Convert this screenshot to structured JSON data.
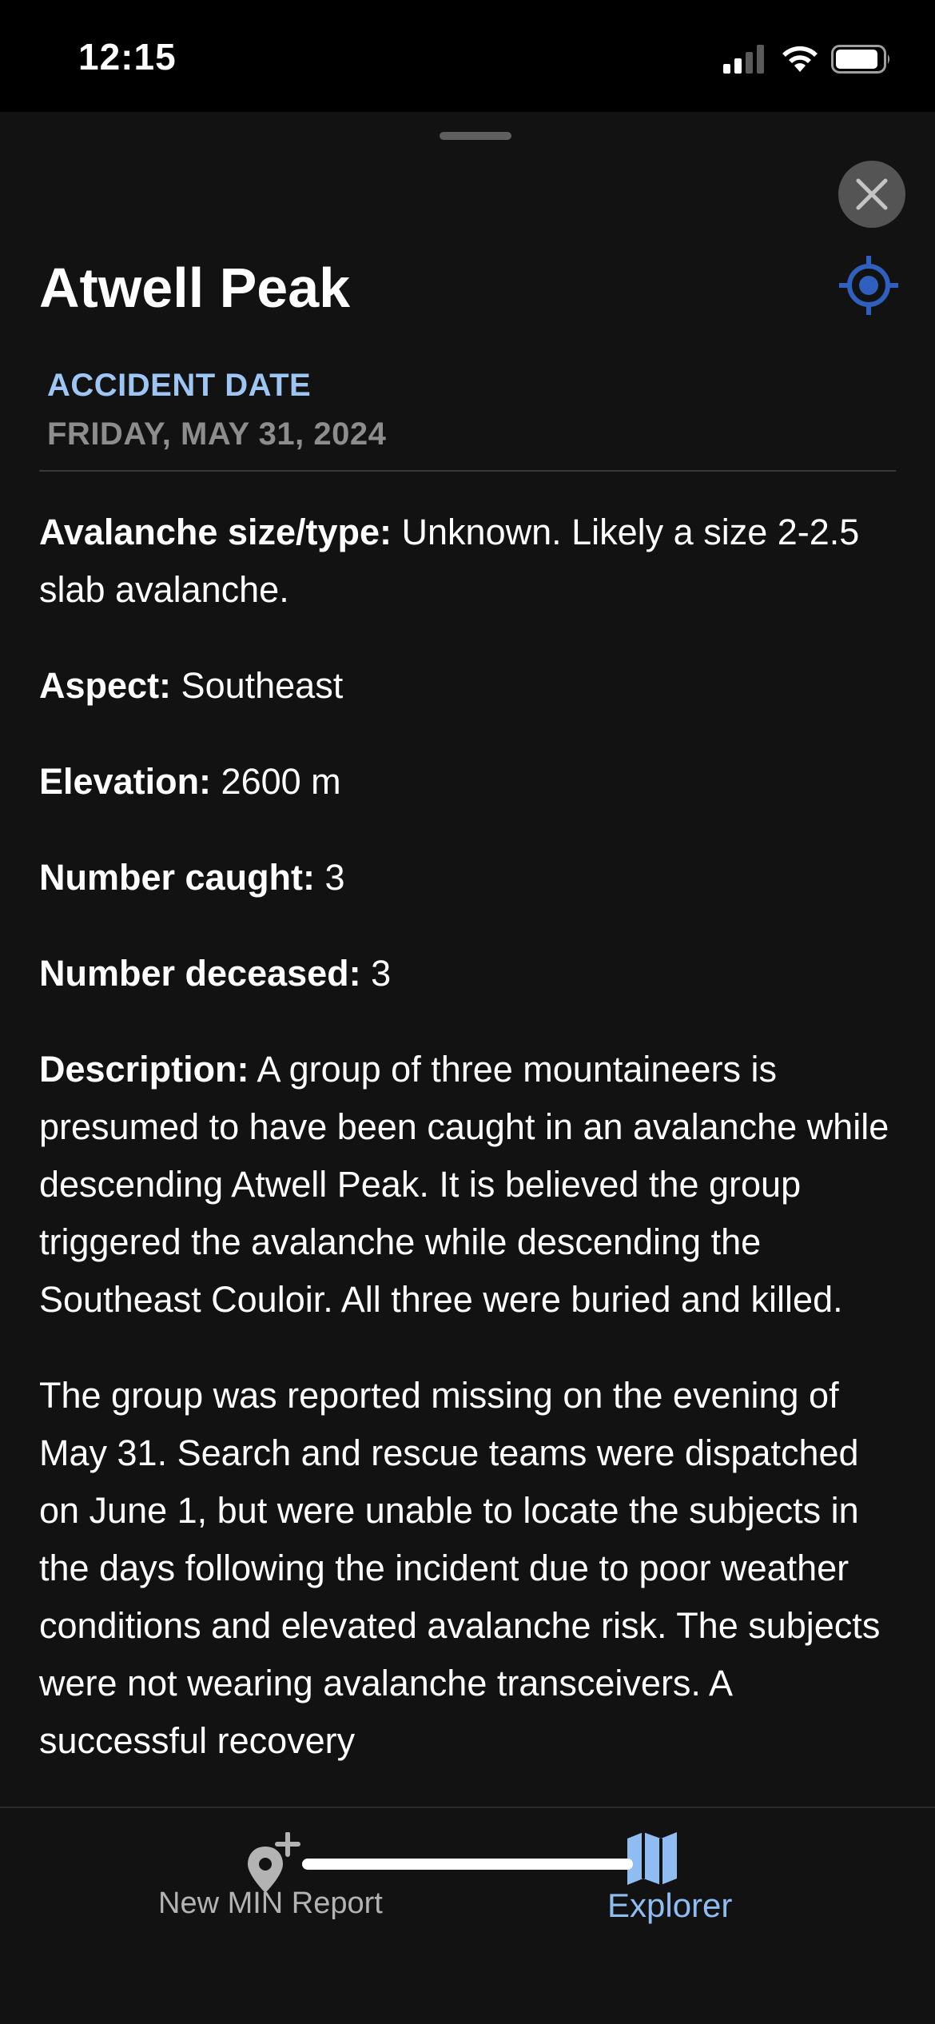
{
  "status_bar": {
    "time": "12:15",
    "icons": [
      "signal-icon",
      "wifi-icon",
      "battery-icon"
    ]
  },
  "sheet": {
    "close_icon": "close-icon",
    "locate_icon": "locate-icon",
    "title": "Atwell Peak",
    "date_label": "ACCIDENT DATE",
    "date_value": "FRIDAY, MAY 31, 2024"
  },
  "details": [
    {
      "label": "Avalanche size/type:",
      "value": " Unknown. Likely a size 2-2.5 slab avalanche."
    },
    {
      "label": "Aspect:",
      "value": " Southeast"
    },
    {
      "label": "Elevation:",
      "value": " 2600 m"
    },
    {
      "label": "Number caught:",
      "value": " 3"
    },
    {
      "label": "Number deceased:",
      "value": " 3"
    },
    {
      "label": "Description:",
      "value": " A group of three mountaineers is presumed to have been caught in an avalanche while descending Atwell Peak. It is believed the group triggered the avalanche while descending the Southeast Couloir. All three were buried and killed."
    }
  ],
  "paragraph": "The group was reported missing on the evening of May 31. Search and rescue teams were dispatched on June 1, but were unable to locate the subjects in the days following the incident due to poor weather conditions and elevated avalanche risk. The subjects were not wearing avalanche transceivers. A successful recovery",
  "tab_bar": {
    "tabs": [
      {
        "label": "New MIN Report",
        "icon": "add-location-icon",
        "active": false
      },
      {
        "label": "Explorer",
        "icon": "map-icon",
        "active": true
      }
    ]
  },
  "colors": {
    "accent": "#9ec6f4",
    "active_tab": "#8fbdf2",
    "locate_icon": "#2f5fbf",
    "background": "#121212"
  }
}
